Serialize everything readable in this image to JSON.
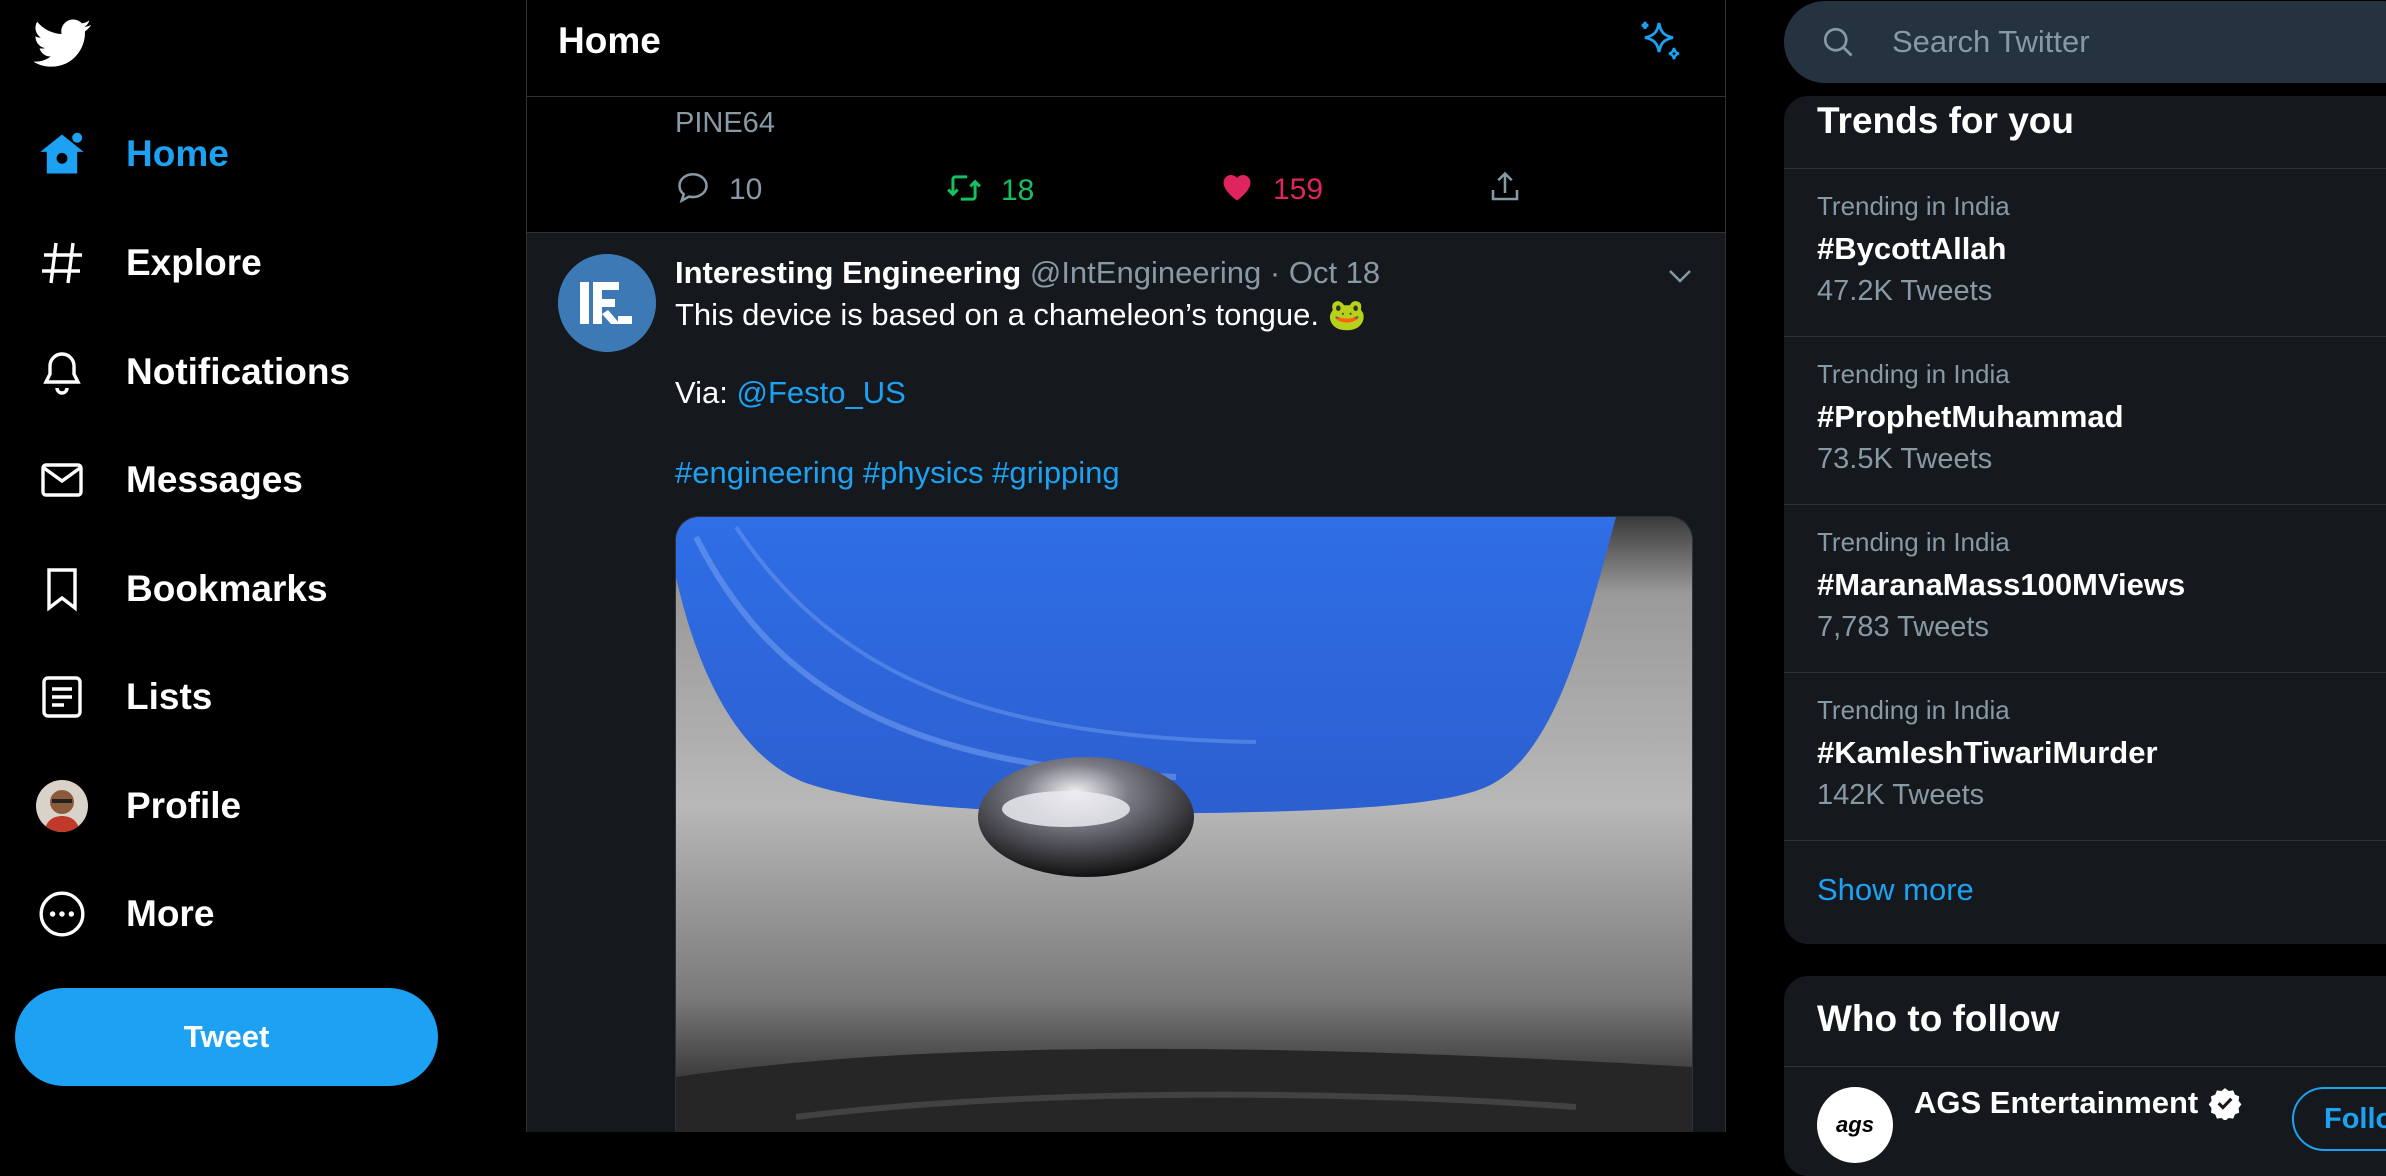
{
  "sidebar": {
    "items": [
      {
        "label": "Home",
        "icon": "home-icon",
        "active": true
      },
      {
        "label": "Explore",
        "icon": "hashtag-icon"
      },
      {
        "label": "Notifications",
        "icon": "bell-icon"
      },
      {
        "label": "Messages",
        "icon": "envelope-icon"
      },
      {
        "label": "Bookmarks",
        "icon": "bookmark-icon"
      },
      {
        "label": "Lists",
        "icon": "list-icon"
      },
      {
        "label": "Profile",
        "icon": "avatar"
      },
      {
        "label": "More",
        "icon": "more-icon"
      }
    ],
    "tweet_button": "Tweet"
  },
  "main": {
    "title": "Home",
    "prev_tweet": {
      "source": "PINE64",
      "replies": "10",
      "retweets": "18",
      "likes": "159"
    },
    "tweet": {
      "name": "Interesting Engineering",
      "handle": "@IntEngineering",
      "sep": "·",
      "date": "Oct 18",
      "text": "This device is based on a chameleon’s tongue. 🐸",
      "via_prefix": "Via: ",
      "via_link": "@Festo_US",
      "hashtags": [
        "#engineering",
        "#physics",
        "#gripping"
      ]
    }
  },
  "search": {
    "placeholder": "Search Twitter"
  },
  "trends": {
    "title": "Trends for you",
    "items": [
      {
        "context": "Trending in India",
        "tag": "#BycottAllah",
        "count": "47.2K Tweets"
      },
      {
        "context": "Trending in India",
        "tag": "#ProphetMuhammad",
        "count": "73.5K Tweets"
      },
      {
        "context": "Trending in India",
        "tag": "#MaranaMass100MViews",
        "count": "7,783 Tweets"
      },
      {
        "context": "Trending in India",
        "tag": "#KamleshTiwariMurder",
        "count": "142K Tweets"
      }
    ],
    "show_more": "Show more"
  },
  "who_to_follow": {
    "title": "Who to follow",
    "accounts": [
      {
        "name": "AGS Entertainment",
        "avatar_text": "ags",
        "verified": true,
        "button": "Follow"
      }
    ]
  },
  "colors": {
    "accent": "#1da1f2",
    "retweet": "#17bf63",
    "like": "#e0245e",
    "muted": "#8899a6"
  }
}
